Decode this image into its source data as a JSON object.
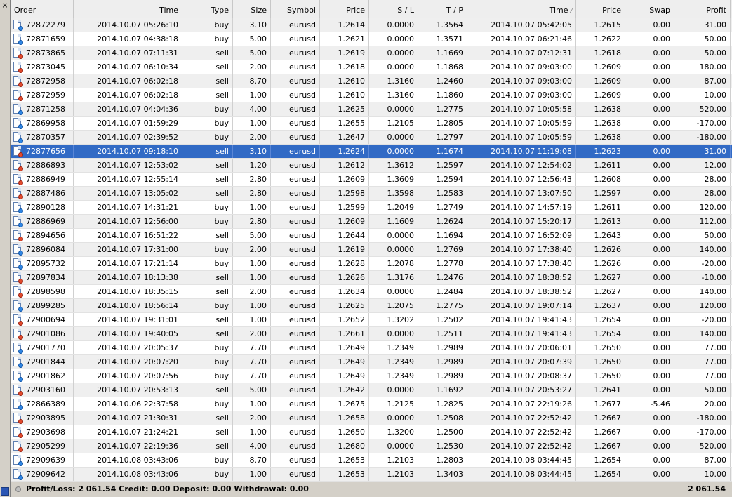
{
  "window": {
    "close_glyph": "×"
  },
  "columns": [
    {
      "key": "order",
      "label": "Order",
      "width": 90,
      "align": "left"
    },
    {
      "key": "time",
      "label": "Time",
      "width": 155
    },
    {
      "key": "type",
      "label": "Type",
      "width": 72
    },
    {
      "key": "size",
      "label": "Size",
      "width": 54
    },
    {
      "key": "symbol",
      "label": "Symbol",
      "width": 70
    },
    {
      "key": "price",
      "label": "Price",
      "width": 70
    },
    {
      "key": "sl",
      "label": "S / L",
      "width": 70
    },
    {
      "key": "tp",
      "label": "T / P",
      "width": 70
    },
    {
      "key": "close_time",
      "label": "Time",
      "width": 155,
      "sorted": true
    },
    {
      "key": "close_price",
      "label": "Price",
      "width": 70
    },
    {
      "key": "swap",
      "label": "Swap",
      "width": 70
    },
    {
      "key": "profit",
      "label": "Profit",
      "width": 80
    }
  ],
  "rows": [
    [
      "72872279",
      "2014.10.07 05:26:10",
      "buy",
      "3.10",
      "eurusd",
      "1.2614",
      "0.0000",
      "1.3564",
      "2014.10.07 05:42:05",
      "1.2615",
      "0.00",
      "31.00"
    ],
    [
      "72871659",
      "2014.10.07 04:38:18",
      "buy",
      "5.00",
      "eurusd",
      "1.2621",
      "0.0000",
      "1.3571",
      "2014.10.07 06:21:46",
      "1.2622",
      "0.00",
      "50.00"
    ],
    [
      "72873865",
      "2014.10.07 07:11:31",
      "sell",
      "5.00",
      "eurusd",
      "1.2619",
      "0.0000",
      "1.1669",
      "2014.10.07 07:12:31",
      "1.2618",
      "0.00",
      "50.00"
    ],
    [
      "72873045",
      "2014.10.07 06:10:34",
      "sell",
      "2.00",
      "eurusd",
      "1.2618",
      "0.0000",
      "1.1868",
      "2014.10.07 09:03:00",
      "1.2609",
      "0.00",
      "180.00"
    ],
    [
      "72872958",
      "2014.10.07 06:02:18",
      "sell",
      "8.70",
      "eurusd",
      "1.2610",
      "1.3160",
      "1.2460",
      "2014.10.07 09:03:00",
      "1.2609",
      "0.00",
      "87.00"
    ],
    [
      "72872959",
      "2014.10.07 06:02:18",
      "sell",
      "1.00",
      "eurusd",
      "1.2610",
      "1.3160",
      "1.1860",
      "2014.10.07 09:03:00",
      "1.2609",
      "0.00",
      "10.00"
    ],
    [
      "72871258",
      "2014.10.07 04:04:36",
      "buy",
      "4.00",
      "eurusd",
      "1.2625",
      "0.0000",
      "1.2775",
      "2014.10.07 10:05:58",
      "1.2638",
      "0.00",
      "520.00"
    ],
    [
      "72869958",
      "2014.10.07 01:59:29",
      "buy",
      "1.00",
      "eurusd",
      "1.2655",
      "1.2105",
      "1.2805",
      "2014.10.07 10:05:59",
      "1.2638",
      "0.00",
      "-170.00"
    ],
    [
      "72870357",
      "2014.10.07 02:39:52",
      "buy",
      "2.00",
      "eurusd",
      "1.2647",
      "0.0000",
      "1.2797",
      "2014.10.07 10:05:59",
      "1.2638",
      "0.00",
      "-180.00"
    ],
    [
      "72877656",
      "2014.10.07 09:18:10",
      "sell",
      "3.10",
      "eurusd",
      "1.2624",
      "0.0000",
      "1.1674",
      "2014.10.07 11:19:08",
      "1.2623",
      "0.00",
      "31.00"
    ],
    [
      "72886893",
      "2014.10.07 12:53:02",
      "sell",
      "1.20",
      "eurusd",
      "1.2612",
      "1.3612",
      "1.2597",
      "2014.10.07 12:54:02",
      "1.2611",
      "0.00",
      "12.00"
    ],
    [
      "72886949",
      "2014.10.07 12:55:14",
      "sell",
      "2.80",
      "eurusd",
      "1.2609",
      "1.3609",
      "1.2594",
      "2014.10.07 12:56:43",
      "1.2608",
      "0.00",
      "28.00"
    ],
    [
      "72887486",
      "2014.10.07 13:05:02",
      "sell",
      "2.80",
      "eurusd",
      "1.2598",
      "1.3598",
      "1.2583",
      "2014.10.07 13:07:50",
      "1.2597",
      "0.00",
      "28.00"
    ],
    [
      "72890128",
      "2014.10.07 14:31:21",
      "buy",
      "1.00",
      "eurusd",
      "1.2599",
      "1.2049",
      "1.2749",
      "2014.10.07 14:57:19",
      "1.2611",
      "0.00",
      "120.00"
    ],
    [
      "72886969",
      "2014.10.07 12:56:00",
      "buy",
      "2.80",
      "eurusd",
      "1.2609",
      "1.1609",
      "1.2624",
      "2014.10.07 15:20:17",
      "1.2613",
      "0.00",
      "112.00"
    ],
    [
      "72894656",
      "2014.10.07 16:51:22",
      "sell",
      "5.00",
      "eurusd",
      "1.2644",
      "0.0000",
      "1.1694",
      "2014.10.07 16:52:09",
      "1.2643",
      "0.00",
      "50.00"
    ],
    [
      "72896084",
      "2014.10.07 17:31:00",
      "buy",
      "2.00",
      "eurusd",
      "1.2619",
      "0.0000",
      "1.2769",
      "2014.10.07 17:38:40",
      "1.2626",
      "0.00",
      "140.00"
    ],
    [
      "72895732",
      "2014.10.07 17:21:14",
      "buy",
      "1.00",
      "eurusd",
      "1.2628",
      "1.2078",
      "1.2778",
      "2014.10.07 17:38:40",
      "1.2626",
      "0.00",
      "-20.00"
    ],
    [
      "72897834",
      "2014.10.07 18:13:38",
      "sell",
      "1.00",
      "eurusd",
      "1.2626",
      "1.3176",
      "1.2476",
      "2014.10.07 18:38:52",
      "1.2627",
      "0.00",
      "-10.00"
    ],
    [
      "72898598",
      "2014.10.07 18:35:15",
      "sell",
      "2.00",
      "eurusd",
      "1.2634",
      "0.0000",
      "1.2484",
      "2014.10.07 18:38:52",
      "1.2627",
      "0.00",
      "140.00"
    ],
    [
      "72899285",
      "2014.10.07 18:56:14",
      "buy",
      "1.00",
      "eurusd",
      "1.2625",
      "1.2075",
      "1.2775",
      "2014.10.07 19:07:14",
      "1.2637",
      "0.00",
      "120.00"
    ],
    [
      "72900694",
      "2014.10.07 19:31:01",
      "sell",
      "1.00",
      "eurusd",
      "1.2652",
      "1.3202",
      "1.2502",
      "2014.10.07 19:41:43",
      "1.2654",
      "0.00",
      "-20.00"
    ],
    [
      "72901086",
      "2014.10.07 19:40:05",
      "sell",
      "2.00",
      "eurusd",
      "1.2661",
      "0.0000",
      "1.2511",
      "2014.10.07 19:41:43",
      "1.2654",
      "0.00",
      "140.00"
    ],
    [
      "72901770",
      "2014.10.07 20:05:37",
      "buy",
      "7.70",
      "eurusd",
      "1.2649",
      "1.2349",
      "1.2989",
      "2014.10.07 20:06:01",
      "1.2650",
      "0.00",
      "77.00"
    ],
    [
      "72901844",
      "2014.10.07 20:07:20",
      "buy",
      "7.70",
      "eurusd",
      "1.2649",
      "1.2349",
      "1.2989",
      "2014.10.07 20:07:39",
      "1.2650",
      "0.00",
      "77.00"
    ],
    [
      "72901862",
      "2014.10.07 20:07:56",
      "buy",
      "7.70",
      "eurusd",
      "1.2649",
      "1.2349",
      "1.2989",
      "2014.10.07 20:08:37",
      "1.2650",
      "0.00",
      "77.00"
    ],
    [
      "72903160",
      "2014.10.07 20:53:13",
      "sell",
      "5.00",
      "eurusd",
      "1.2642",
      "0.0000",
      "1.1692",
      "2014.10.07 20:53:27",
      "1.2641",
      "0.00",
      "50.00"
    ],
    [
      "72866389",
      "2014.10.06 22:37:58",
      "buy",
      "1.00",
      "eurusd",
      "1.2675",
      "1.2125",
      "1.2825",
      "2014.10.07 22:19:26",
      "1.2677",
      "-5.46",
      "20.00"
    ],
    [
      "72903895",
      "2014.10.07 21:30:31",
      "sell",
      "2.00",
      "eurusd",
      "1.2658",
      "0.0000",
      "1.2508",
      "2014.10.07 22:52:42",
      "1.2667",
      "0.00",
      "-180.00"
    ],
    [
      "72903698",
      "2014.10.07 21:24:21",
      "sell",
      "1.00",
      "eurusd",
      "1.2650",
      "1.3200",
      "1.2500",
      "2014.10.07 22:52:42",
      "1.2667",
      "0.00",
      "-170.00"
    ],
    [
      "72905299",
      "2014.10.07 22:19:36",
      "sell",
      "4.00",
      "eurusd",
      "1.2680",
      "0.0000",
      "1.2530",
      "2014.10.07 22:52:42",
      "1.2667",
      "0.00",
      "520.00"
    ],
    [
      "72909639",
      "2014.10.08 03:43:06",
      "buy",
      "8.70",
      "eurusd",
      "1.2653",
      "1.2103",
      "1.2803",
      "2014.10.08 03:44:45",
      "1.2654",
      "0.00",
      "87.00"
    ],
    [
      "72909642",
      "2014.10.08 03:43:06",
      "buy",
      "1.00",
      "eurusd",
      "1.2653",
      "1.2103",
      "1.3403",
      "2014.10.08 03:44:45",
      "1.2654",
      "0.00",
      "10.00"
    ]
  ],
  "selected_row_index": 9,
  "footer": {
    "summary": [
      "Profit/Loss: 2 061.54",
      "Credit: 0.00",
      "Deposit: 0.00",
      "Withdrawal: 0.00"
    ],
    "total": "2 061.54"
  },
  "colors": {
    "selection": "#316ac5",
    "buy_marker": "#2f86e4",
    "sell_marker": "#e24a2c",
    "alt_row": "#efefef",
    "panel": "#d4d0c8"
  }
}
